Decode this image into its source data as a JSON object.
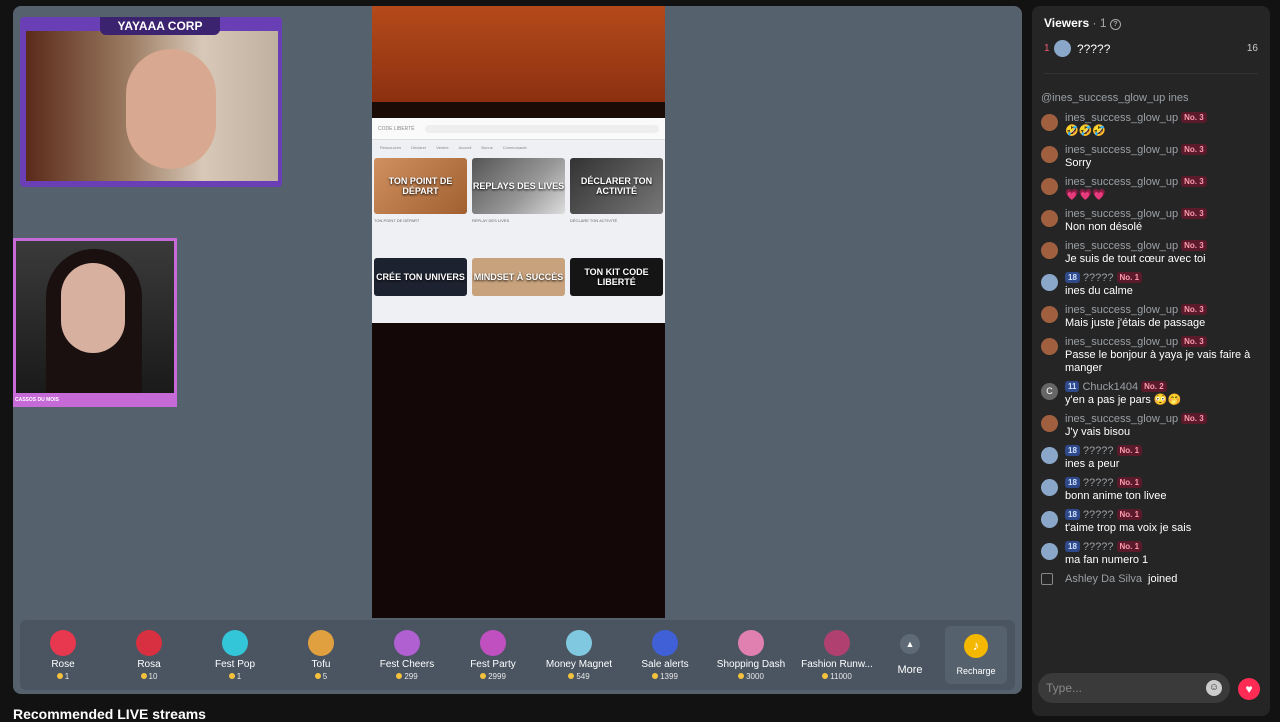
{
  "stream": {
    "cam1_label": "YAYAAA CORP",
    "cam2_label": "CASSOS DU MOIS",
    "screen": {
      "topbar": [
        "CODE LIBERTÉ"
      ],
      "nav": [
        "Ressources",
        "Déclarer",
        "Ventes",
        "Accueil",
        "Bonus",
        "Communauté"
      ],
      "tiles_row1": [
        "TON POINT DE DÉPART",
        "REPLAYS DES LIVES",
        "DÉCLARER TON ACTIVITÉ"
      ],
      "captions": [
        "TON POINT DE DÉPART",
        "REPLAY DES LIVES",
        "DÉCLARE TON ACTIVITÉ"
      ],
      "tiles_row2": [
        "CRÉE TON UNIVERS",
        "MINDSET À SUCCÈS",
        "TON KIT CODE LIBERTÉ"
      ]
    }
  },
  "gifts": [
    {
      "name": "Rose",
      "price": "1",
      "color": "#e8384f"
    },
    {
      "name": "Rosa",
      "price": "10",
      "color": "#d83040"
    },
    {
      "name": "Fest Pop",
      "price": "1",
      "color": "#33c6d8"
    },
    {
      "name": "Tofu",
      "price": "5",
      "color": "#e0a040"
    },
    {
      "name": "Fest Cheers",
      "price": "299",
      "color": "#b060d0"
    },
    {
      "name": "Fest Party",
      "price": "2999",
      "color": "#c050c0"
    },
    {
      "name": "Money Magnet",
      "price": "549",
      "color": "#80c8e0"
    },
    {
      "name": "Sale alerts",
      "price": "1399",
      "color": "#4060d8"
    },
    {
      "name": "Shopping Dash",
      "price": "3000",
      "color": "#e080b0"
    },
    {
      "name": "Fashion Runw...",
      "price": "11000",
      "color": "#b04070"
    }
  ],
  "more_label": "More",
  "recharge_label": "Recharge",
  "recommended": "Recommended LIVE streams",
  "viewers": {
    "title": "Viewers",
    "count": "1",
    "top": {
      "rank": "1",
      "name": "?????",
      "score": "16"
    }
  },
  "chat_sys": "@ines_success_glow_up ines",
  "chat": [
    {
      "user": "ines_success_glow_up",
      "badge": "No. 3",
      "text": "🤣🤣🤣",
      "av": "b"
    },
    {
      "user": "ines_success_glow_up",
      "badge": "No. 3",
      "text": "Sorry",
      "av": "b"
    },
    {
      "user": "ines_success_glow_up",
      "badge": "No. 3",
      "text": "💗💗💗",
      "av": "b"
    },
    {
      "user": "ines_success_glow_up",
      "badge": "No. 3",
      "text": "Non non désolé",
      "av": "b"
    },
    {
      "user": "ines_success_glow_up",
      "badge": "No. 3",
      "text": "Je suis de tout cœur avec toi",
      "av": "b"
    },
    {
      "user": "?????",
      "lvl": "18",
      "badge": "No. 1",
      "text": "ines du calme",
      "av": ""
    },
    {
      "user": "ines_success_glow_up",
      "badge": "No. 3",
      "text": "Mais juste j'étais de passage",
      "av": "b"
    },
    {
      "user": "ines_success_glow_up",
      "badge": "No. 3",
      "text": "Passe le bonjour à yaya je vais faire à manger",
      "av": "b"
    },
    {
      "user": "Chuck1404",
      "lvl": "11",
      "badge": "No. 2",
      "text": "y'en a pas je pars 😳🤭",
      "av": "c"
    },
    {
      "user": "ines_success_glow_up",
      "badge": "No. 3",
      "text": "J'y vais bisou",
      "av": "b"
    },
    {
      "user": "?????",
      "lvl": "18",
      "badge": "No. 1",
      "text": "ines a peur",
      "av": ""
    },
    {
      "user": "?????",
      "lvl": "18",
      "badge": "No. 1",
      "text": "bonn anime ton livee",
      "av": ""
    },
    {
      "user": "?????",
      "lvl": "18",
      "badge": "No. 1",
      "text": "t'aime trop ma voix je sais",
      "av": ""
    },
    {
      "user": "?????",
      "lvl": "18",
      "badge": "No. 1",
      "text": "ma fan numero 1",
      "av": ""
    }
  ],
  "joined": {
    "name": "Ashley Da Silva",
    "text": "joined"
  },
  "input_placeholder": "Type..."
}
